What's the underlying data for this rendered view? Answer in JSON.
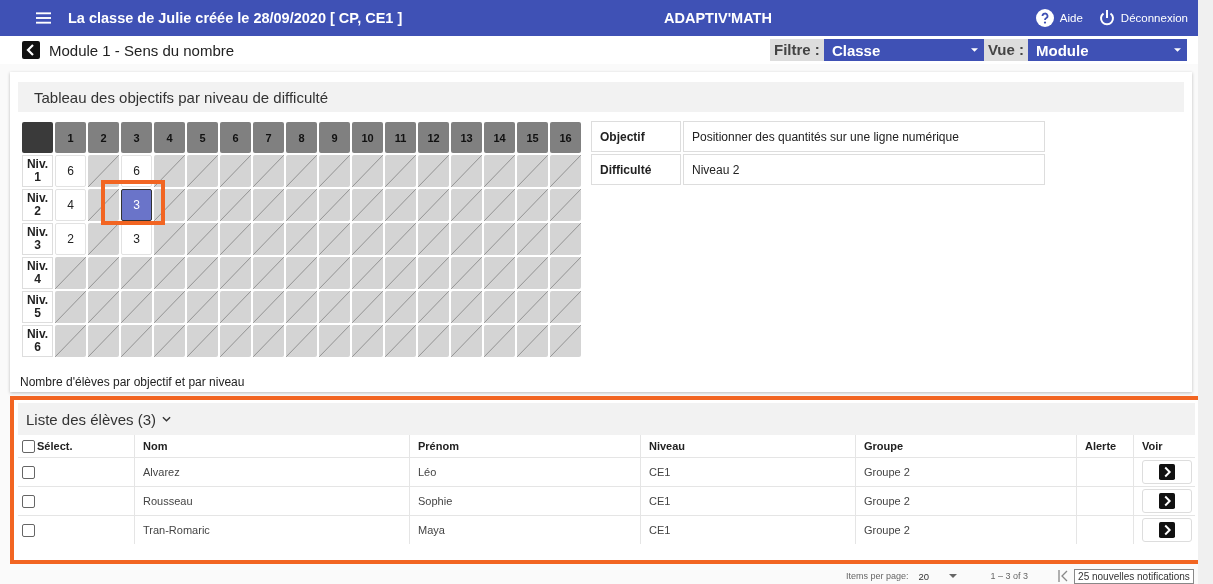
{
  "header": {
    "title": "La classe de Julie créée le 28/09/2020 [ CP, CE1 ]",
    "app_name": "ADAPTIV'MATH",
    "help": "Aide",
    "logout": "Déconnexion"
  },
  "subheader": {
    "module": "Module 1 - Sens du nombre",
    "filter_label": "Filtre :",
    "filter_value": "Classe",
    "view_label": "Vue :",
    "view_value": "Module"
  },
  "objectives_panel": {
    "title": "Tableau des objectifs par niveau de difficulté",
    "columns": [
      "1",
      "2",
      "3",
      "4",
      "5",
      "6",
      "7",
      "8",
      "9",
      "10",
      "11",
      "12",
      "13",
      "14",
      "15",
      "16"
    ],
    "levels": [
      {
        "label": "Niv. 1",
        "cells": [
          {
            "kind": "count",
            "value": "6",
            "selected": false
          },
          {
            "kind": "blank",
            "selected": false
          },
          {
            "kind": "count",
            "value": "6",
            "selected": false
          },
          {
            "kind": "blank",
            "selected": false
          },
          {
            "kind": "blank",
            "selected": false
          },
          {
            "kind": "blank",
            "selected": false
          },
          {
            "kind": "blank",
            "selected": false
          },
          {
            "kind": "blank",
            "selected": false
          },
          {
            "kind": "blank",
            "selected": false
          },
          {
            "kind": "blank",
            "selected": false
          },
          {
            "kind": "blank",
            "selected": false
          },
          {
            "kind": "blank",
            "selected": false
          },
          {
            "kind": "blank",
            "selected": false
          },
          {
            "kind": "blank",
            "selected": false
          },
          {
            "kind": "blank",
            "selected": false
          },
          {
            "kind": "blank",
            "selected": false
          }
        ]
      },
      {
        "label": "Niv. 2",
        "cells": [
          {
            "kind": "count",
            "value": "4",
            "selected": false
          },
          {
            "kind": "blank",
            "selected": false
          },
          {
            "kind": "count",
            "value": "3",
            "selected": true,
            "highlighted": true
          },
          {
            "kind": "blank",
            "selected": false
          },
          {
            "kind": "blank",
            "selected": false
          },
          {
            "kind": "blank",
            "selected": false
          },
          {
            "kind": "blank",
            "selected": false
          },
          {
            "kind": "blank",
            "selected": false
          },
          {
            "kind": "blank",
            "selected": false
          },
          {
            "kind": "blank",
            "selected": false
          },
          {
            "kind": "blank",
            "selected": false
          },
          {
            "kind": "blank",
            "selected": false
          },
          {
            "kind": "blank",
            "selected": false
          },
          {
            "kind": "blank",
            "selected": false
          },
          {
            "kind": "blank",
            "selected": false
          },
          {
            "kind": "blank",
            "selected": false
          }
        ]
      },
      {
        "label": "Niv. 3",
        "cells": [
          {
            "kind": "count",
            "value": "2",
            "selected": false
          },
          {
            "kind": "blank",
            "selected": false
          },
          {
            "kind": "count",
            "value": "3",
            "selected": false
          },
          {
            "kind": "blank",
            "selected": false
          },
          {
            "kind": "blank",
            "selected": false
          },
          {
            "kind": "blank",
            "selected": false
          },
          {
            "kind": "blank",
            "selected": false
          },
          {
            "kind": "blank",
            "selected": false
          },
          {
            "kind": "blank",
            "selected": false
          },
          {
            "kind": "blank",
            "selected": false
          },
          {
            "kind": "blank",
            "selected": false
          },
          {
            "kind": "blank",
            "selected": false
          },
          {
            "kind": "blank",
            "selected": false
          },
          {
            "kind": "blank",
            "selected": false
          },
          {
            "kind": "blank",
            "selected": false
          },
          {
            "kind": "blank",
            "selected": false
          }
        ]
      },
      {
        "label": "Niv. 4",
        "cells": [
          {
            "kind": "blank",
            "selected": false
          },
          {
            "kind": "blank",
            "selected": false
          },
          {
            "kind": "blank",
            "selected": false
          },
          {
            "kind": "blank",
            "selected": false
          },
          {
            "kind": "blank",
            "selected": false
          },
          {
            "kind": "blank",
            "selected": false
          },
          {
            "kind": "blank",
            "selected": false
          },
          {
            "kind": "blank",
            "selected": false
          },
          {
            "kind": "blank",
            "selected": false
          },
          {
            "kind": "blank",
            "selected": false
          },
          {
            "kind": "blank",
            "selected": false
          },
          {
            "kind": "blank",
            "selected": false
          },
          {
            "kind": "blank",
            "selected": false
          },
          {
            "kind": "blank",
            "selected": false
          },
          {
            "kind": "blank",
            "selected": false
          },
          {
            "kind": "blank",
            "selected": false
          }
        ]
      },
      {
        "label": "Niv. 5",
        "cells": [
          {
            "kind": "blank",
            "selected": false
          },
          {
            "kind": "blank",
            "selected": false
          },
          {
            "kind": "blank",
            "selected": false
          },
          {
            "kind": "blank",
            "selected": false
          },
          {
            "kind": "blank",
            "selected": false
          },
          {
            "kind": "blank",
            "selected": false
          },
          {
            "kind": "blank",
            "selected": false
          },
          {
            "kind": "blank",
            "selected": false
          },
          {
            "kind": "blank",
            "selected": false
          },
          {
            "kind": "blank",
            "selected": false
          },
          {
            "kind": "blank",
            "selected": false
          },
          {
            "kind": "blank",
            "selected": false
          },
          {
            "kind": "blank",
            "selected": false
          },
          {
            "kind": "blank",
            "selected": false
          },
          {
            "kind": "blank",
            "selected": false
          },
          {
            "kind": "blank",
            "selected": false
          }
        ]
      },
      {
        "label": "Niv. 6",
        "cells": [
          {
            "kind": "blank",
            "selected": false
          },
          {
            "kind": "blank",
            "selected": false
          },
          {
            "kind": "blank",
            "selected": false
          },
          {
            "kind": "blank",
            "selected": false
          },
          {
            "kind": "blank",
            "selected": false
          },
          {
            "kind": "blank",
            "selected": false
          },
          {
            "kind": "blank",
            "selected": false
          },
          {
            "kind": "blank",
            "selected": false
          },
          {
            "kind": "blank",
            "selected": false
          },
          {
            "kind": "blank",
            "selected": false
          },
          {
            "kind": "blank",
            "selected": false
          },
          {
            "kind": "blank",
            "selected": false
          },
          {
            "kind": "blank",
            "selected": false
          },
          {
            "kind": "blank",
            "selected": false
          },
          {
            "kind": "blank",
            "selected": false
          },
          {
            "kind": "blank",
            "selected": false
          }
        ]
      }
    ],
    "details": [
      {
        "label": "Objectif",
        "value": "Positionner des quantités sur une ligne numérique"
      },
      {
        "label": "Difficulté",
        "value": "Niveau 2"
      }
    ],
    "caption": "Nombre d'élèves par objectif et par niveau"
  },
  "students": {
    "title": "Liste des élèves (3)",
    "expanded": true,
    "highlighted": true,
    "columns": [
      "Sélect.",
      "Nom",
      "Prénom",
      "Niveau",
      "Groupe",
      "Alerte",
      "Voir"
    ],
    "select_all_checked": false,
    "rows": [
      {
        "nom": "Alvarez",
        "prenom": "Léo",
        "niveau": "CE1",
        "groupe": "Groupe 2",
        "checked": false
      },
      {
        "nom": "Rousseau",
        "prenom": "Sophie",
        "niveau": "CE1",
        "groupe": "Groupe 2",
        "checked": false
      },
      {
        "nom": "Tran-Romaric",
        "prenom": "Maya",
        "niveau": "CE1",
        "groupe": "Groupe 2",
        "checked": false
      }
    ]
  },
  "paginator": {
    "items_per_page_label": "Items per page:",
    "items_per_page": "20",
    "range": "1 – 3 of 3"
  },
  "notification": "25 nouvelles notifications"
}
